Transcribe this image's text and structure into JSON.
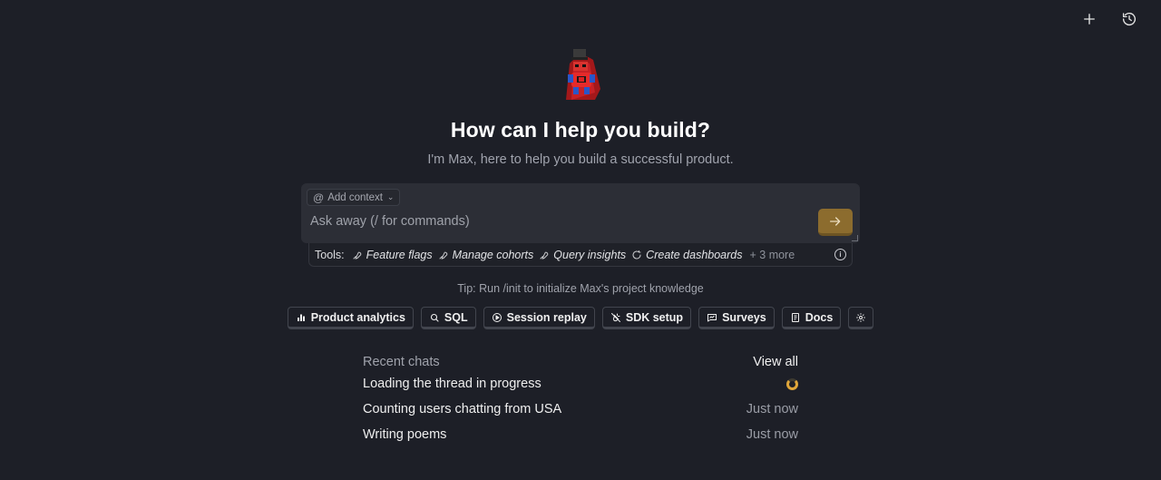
{
  "header": {
    "new_chat_icon": "plus-icon",
    "history_icon": "history-icon"
  },
  "hero": {
    "mascot": "hedgehog-mascot",
    "headline": "How can I help you build?",
    "subline": "I'm Max, here to help you build a successful product."
  },
  "composer": {
    "context_label": "Add context",
    "placeholder": "Ask away (/ for commands)",
    "value": "",
    "send_icon": "arrow-right-icon",
    "accent_color": "#8c6c2e"
  },
  "tools": {
    "label": "Tools:",
    "items": [
      {
        "label": "Feature flags",
        "icon": "wrench-icon"
      },
      {
        "label": "Manage cohorts",
        "icon": "wrench-icon"
      },
      {
        "label": "Query insights",
        "icon": "wrench-icon"
      },
      {
        "label": "Create dashboards",
        "icon": "refresh-icon"
      }
    ],
    "more": "+ 3 more",
    "info_icon": "info-icon"
  },
  "tip": "Tip: Run /init to initialize Max's project knowledge",
  "suggestions": [
    {
      "label": "Product analytics",
      "icon": "bar-chart-icon"
    },
    {
      "label": "SQL",
      "icon": "database-search-icon"
    },
    {
      "label": "Session replay",
      "icon": "play-circle-icon"
    },
    {
      "label": "SDK setup",
      "icon": "plug-icon"
    },
    {
      "label": "Surveys",
      "icon": "survey-icon"
    },
    {
      "label": "Docs",
      "icon": "document-icon"
    }
  ],
  "settings_icon": "gear-icon",
  "recent": {
    "title": "Recent chats",
    "view_all": "View all",
    "chats": [
      {
        "title": "Loading the thread in progress",
        "status": "loading"
      },
      {
        "title": "Counting users chatting from USA",
        "time": "Just now"
      },
      {
        "title": "Writing poems",
        "time": "Just now"
      }
    ]
  }
}
